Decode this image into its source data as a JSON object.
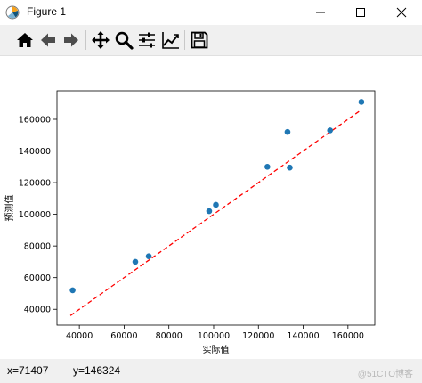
{
  "window": {
    "title": "Figure 1",
    "app_icon": "matplotlib-icon",
    "controls": [
      "minimize-icon",
      "maximize-icon",
      "close-icon"
    ]
  },
  "toolbar": {
    "buttons": [
      "home-icon",
      "back-icon",
      "forward-icon",
      "pan-icon",
      "zoom-icon",
      "configure-subplots-icon",
      "edit-axis-icon",
      "save-icon"
    ]
  },
  "chart_data": {
    "type": "scatter",
    "xlabel": "实际值",
    "ylabel": "预测值",
    "xlim": [
      30000,
      172000
    ],
    "ylim": [
      30000,
      178000
    ],
    "xticks": [
      "40000",
      "60000",
      "80000",
      "100000",
      "120000",
      "140000",
      "160000"
    ],
    "yticks": [
      "40000",
      "60000",
      "80000",
      "100000",
      "120000",
      "140000",
      "160000"
    ],
    "series": [
      {
        "points": [
          [
            37000,
            52000
          ],
          [
            65000,
            70000
          ],
          [
            71000,
            73500
          ],
          [
            98000,
            102000
          ],
          [
            101000,
            106000
          ],
          [
            124000,
            130000
          ],
          [
            133000,
            152000
          ],
          [
            134000,
            129500
          ],
          [
            152000,
            153000
          ],
          [
            166000,
            171000
          ]
        ],
        "color": "#1f77b4"
      }
    ],
    "reference_line": {
      "x": [
        36000,
        166000
      ],
      "y": [
        36000,
        166000
      ],
      "color": "#ff0000",
      "style": "dashed"
    },
    "grid": false
  },
  "status": {
    "x_readout": "x=71407",
    "y_readout": "y=146324",
    "watermark": "@51CTO博客"
  }
}
